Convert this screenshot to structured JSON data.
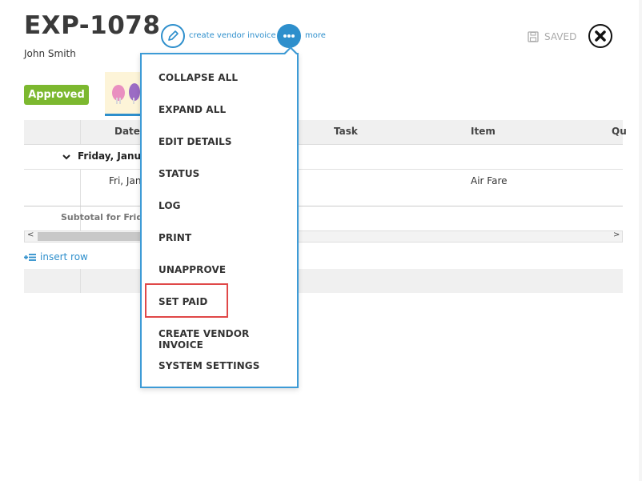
{
  "header": {
    "title": "EXP-1078",
    "user": "John Smith",
    "create_vendor_invoice_label": "create vendor invoice",
    "more_label": "more",
    "saved_label": "SAVED"
  },
  "status_badge": "Approved",
  "table": {
    "columns": [
      "Date",
      "Task",
      "Item",
      "Qu"
    ],
    "group_label": "Friday, Janua",
    "rows": [
      {
        "date": "Fri, Jan",
        "task": "",
        "item": "Air Fare"
      }
    ],
    "subtotal_label": "Subtotal for Frid",
    "scroll_left": "<",
    "scroll_right": ">"
  },
  "insert_row_label": "insert row",
  "menu": {
    "items": [
      "COLLAPSE ALL",
      "EXPAND ALL",
      "EDIT DETAILS",
      "STATUS",
      "LOG",
      "PRINT",
      "UNAPPROVE",
      "SET PAID",
      "CREATE VENDOR INVOICE",
      "SYSTEM SETTINGS"
    ],
    "highlighted": "SET PAID"
  },
  "colors": {
    "accent": "#2e8fcc",
    "approved": "#7cb82f",
    "highlight_box": "#e04848"
  },
  "icons": {
    "create_vendor_invoice": "pencil-icon",
    "more": "ellipsis-icon",
    "saved": "floppy-disk-icon",
    "close": "close-icon",
    "insert_row": "insert-row-icon",
    "group_toggle": "chevron-down-icon"
  }
}
